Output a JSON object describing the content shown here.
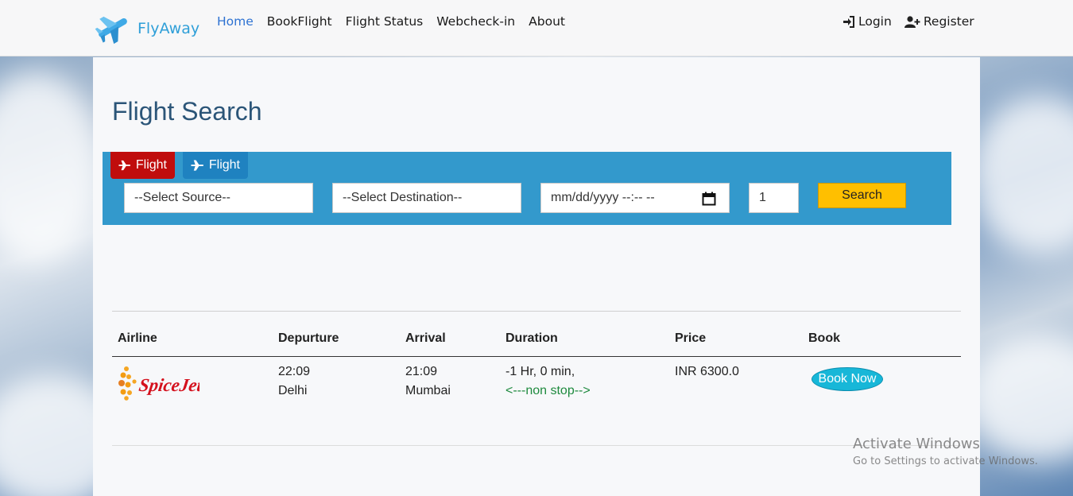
{
  "brand": {
    "name": "FlyAway",
    "icon": "airplane-logo"
  },
  "nav": {
    "links": [
      "Home",
      "BookFlight",
      "Flight Status",
      "Webcheck-in",
      "About"
    ],
    "login": "Login",
    "register": "Register"
  },
  "page_title": "Flight Search",
  "search": {
    "tabs": [
      "Flight",
      "Flight"
    ],
    "source_placeholder": "--Select Source--",
    "destination_placeholder": "--Select Destination--",
    "datetime_placeholder": "mm/dd/yyyy --:-- --",
    "passengers": "1",
    "search_label": "Search"
  },
  "table": {
    "headers": [
      "Airline",
      "Depurture",
      "Arrival",
      "Duration",
      "Price",
      "Book"
    ],
    "rows": [
      {
        "airline_logo": "SpiceJet",
        "departure_time": "22:09",
        "departure_city": "Delhi",
        "arrival_time": "21:09",
        "arrival_city": "Mumbai",
        "duration": "-1 Hr, 0 min,",
        "stops": "<---non stop-->",
        "price": "INR 6300.0",
        "book_label": "Book Now"
      }
    ]
  },
  "watermark": {
    "line1": "Activate Windows",
    "line2": "Go to Settings to activate Windows."
  },
  "colors": {
    "brand": "#2f9fd8",
    "active_nav": "#2e72d2",
    "search_panel": "#3399cc",
    "tab_active": "#c00d0d",
    "tab_inactive": "#1f82c0",
    "search_button": "#ffbf00",
    "book_button": "#17b7d8"
  }
}
